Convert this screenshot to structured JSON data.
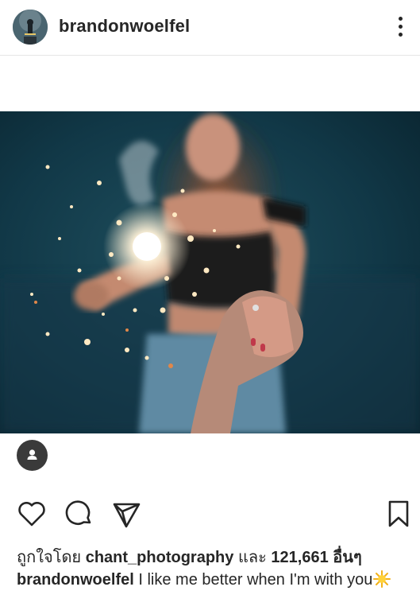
{
  "post": {
    "username": "brandonwoelfel",
    "likes_prefix": "ถูกใจโดย",
    "liked_by": "chant_photography",
    "likes_joiner": "และ",
    "likes_count": "121,661",
    "likes_suffix": "อื่นๆ",
    "caption_user": "brandonwoelfel",
    "caption_text": "I like me better when I'm with you",
    "caption_emoji": "sparkle-sun"
  },
  "icons": {
    "more": "more-vertical-icon",
    "like": "heart-icon",
    "comment": "comment-icon",
    "share": "send-icon",
    "save": "bookmark-icon",
    "tag": "person-tag-icon"
  },
  "colors": {
    "text": "#262626",
    "divider": "#e6e6e6",
    "photo_bg": "#0f3441"
  }
}
